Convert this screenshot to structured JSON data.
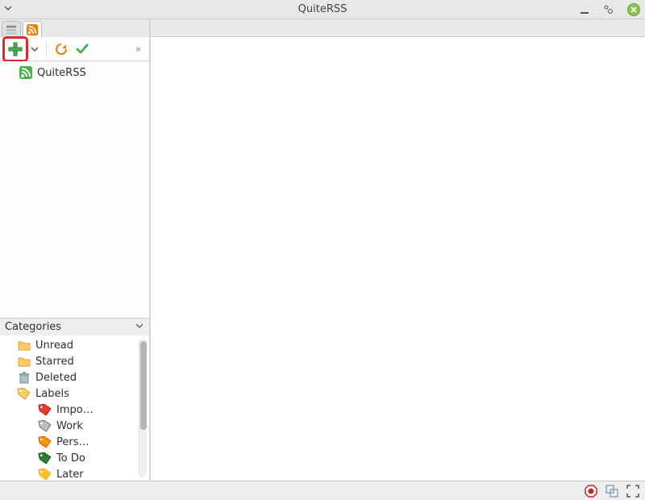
{
  "window": {
    "title": "QuiteRSS"
  },
  "feeds": {
    "items": [
      {
        "name": "QuiteRSS"
      }
    ]
  },
  "categories": {
    "title": "Categories",
    "items": [
      {
        "icon": "folder",
        "label": "Unread"
      },
      {
        "icon": "folder",
        "label": "Starred"
      },
      {
        "icon": "trash",
        "label": "Deleted"
      }
    ],
    "labels_header": "Labels",
    "labels": [
      {
        "color": "#e53935",
        "label": "Impo…"
      },
      {
        "color": "#9e9e9e",
        "label": "Work"
      },
      {
        "color": "#ff9800",
        "label": "Pers…"
      },
      {
        "color": "#2e7d32",
        "label": "To Do"
      },
      {
        "color": "#fbc02d",
        "label": "Later"
      }
    ]
  }
}
